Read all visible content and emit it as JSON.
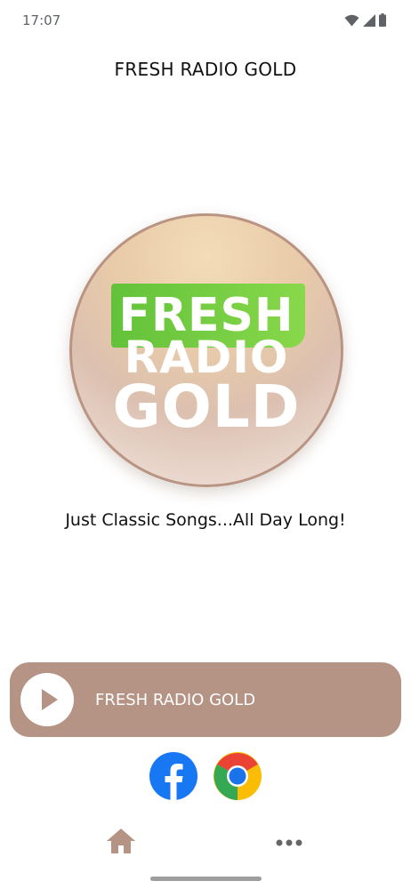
{
  "status_bar": {
    "time": "17:07",
    "icons": [
      "wifi-icon",
      "signal-icon",
      "battery-icon"
    ]
  },
  "header": {
    "title": "FRESH RADIO GOLD"
  },
  "logo": {
    "line1": "FRESH",
    "line2": "RADIO",
    "line3": "GOLD"
  },
  "tagline": "Just Classic Songs...All Day Long!",
  "player": {
    "station_name": "FRESH RADIO GOLD",
    "play_icon": "play-icon"
  },
  "social": {
    "items": [
      "facebook-icon",
      "chrome-icon"
    ]
  },
  "bottom_nav": {
    "items": [
      "home-icon",
      "more-icon"
    ]
  },
  "colors": {
    "accent": "#b59385",
    "logo_green": "#76cd43",
    "facebook_blue": "#1877f2"
  }
}
